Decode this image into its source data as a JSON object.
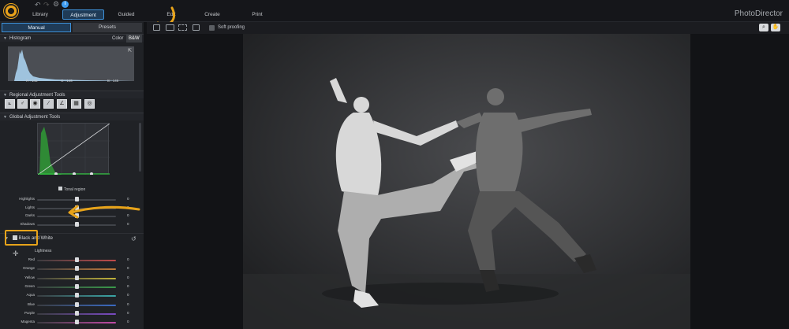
{
  "app": {
    "title": "PhotoDirector"
  },
  "nav": {
    "tabs": [
      "Library",
      "Adjustment",
      "Guided",
      "Edit",
      "Create",
      "Print"
    ],
    "active": "Adjustment"
  },
  "panel": {
    "modes": [
      "Manual",
      "Presets"
    ],
    "histogram": {
      "title": "Histogram",
      "color_label": "Color",
      "bw_label": "B&W",
      "r": "R : 145",
      "g": "G : 145",
      "b": "B : 145"
    },
    "regional": {
      "title": "Regional Adjustment Tools"
    },
    "global": {
      "title": "Global Adjustment Tools"
    },
    "tonal_region": "Tonal region",
    "tone_sliders": [
      {
        "label": "Highlights",
        "value": "0"
      },
      {
        "label": "Lights",
        "value": "0"
      },
      {
        "label": "Darks",
        "value": "0"
      },
      {
        "label": "Shadows",
        "value": "0"
      }
    ],
    "bw": {
      "title": "Black and White",
      "lightness": "Lightness"
    },
    "color_sliders": [
      {
        "label": "Red",
        "value": "0"
      },
      {
        "label": "Orange",
        "value": "0"
      },
      {
        "label": "Yellow",
        "value": "0"
      },
      {
        "label": "Green",
        "value": "0"
      },
      {
        "label": "Aqua",
        "value": "0"
      },
      {
        "label": "Blue",
        "value": "0"
      },
      {
        "label": "Purple",
        "value": "0"
      },
      {
        "label": "Magenta",
        "value": "0"
      }
    ]
  },
  "toolbar": {
    "soft_proofing": "Soft proofing"
  },
  "colors": {
    "accent": "#e7a31a",
    "active_tab": "#3d8fd6"
  },
  "icons": [
    "logo-icon",
    "undo-icon",
    "redo-icon",
    "gear-icon",
    "info-icon",
    "zoom-icon",
    "hand-icon",
    "reset-icon"
  ]
}
